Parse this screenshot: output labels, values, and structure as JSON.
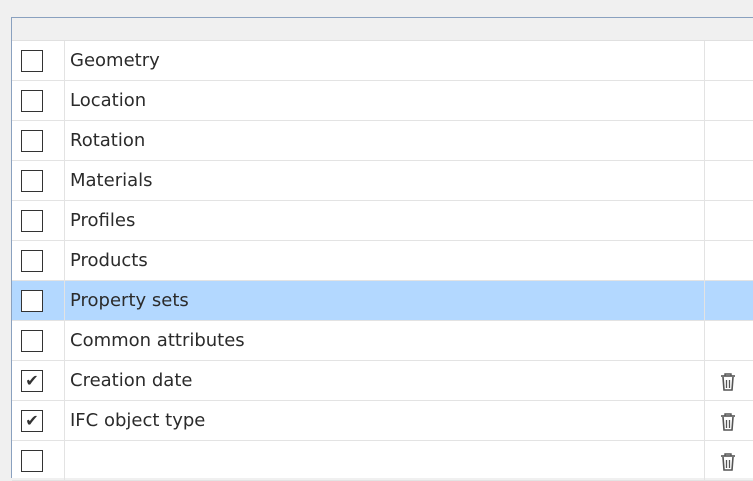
{
  "rows": [
    {
      "label": "Geometry",
      "checked": false,
      "selected": false,
      "deletable": false
    },
    {
      "label": "Location",
      "checked": false,
      "selected": false,
      "deletable": false
    },
    {
      "label": "Rotation",
      "checked": false,
      "selected": false,
      "deletable": false
    },
    {
      "label": "Materials",
      "checked": false,
      "selected": false,
      "deletable": false
    },
    {
      "label": "Profiles",
      "checked": false,
      "selected": false,
      "deletable": false
    },
    {
      "label": "Products",
      "checked": false,
      "selected": false,
      "deletable": false
    },
    {
      "label": "Property sets",
      "checked": false,
      "selected": true,
      "deletable": false
    },
    {
      "label": "Common attributes",
      "checked": false,
      "selected": false,
      "deletable": false
    },
    {
      "label": "Creation date",
      "checked": true,
      "selected": false,
      "deletable": true
    },
    {
      "label": "IFC object type",
      "checked": true,
      "selected": false,
      "deletable": true
    },
    {
      "label": "",
      "checked": false,
      "selected": false,
      "deletable": true
    }
  ],
  "icons": {
    "check": "checkmark-icon",
    "delete": "trash-icon"
  },
  "colors": {
    "selected_row": "#b3d8ff",
    "panel_border": "#8aa1bf"
  }
}
